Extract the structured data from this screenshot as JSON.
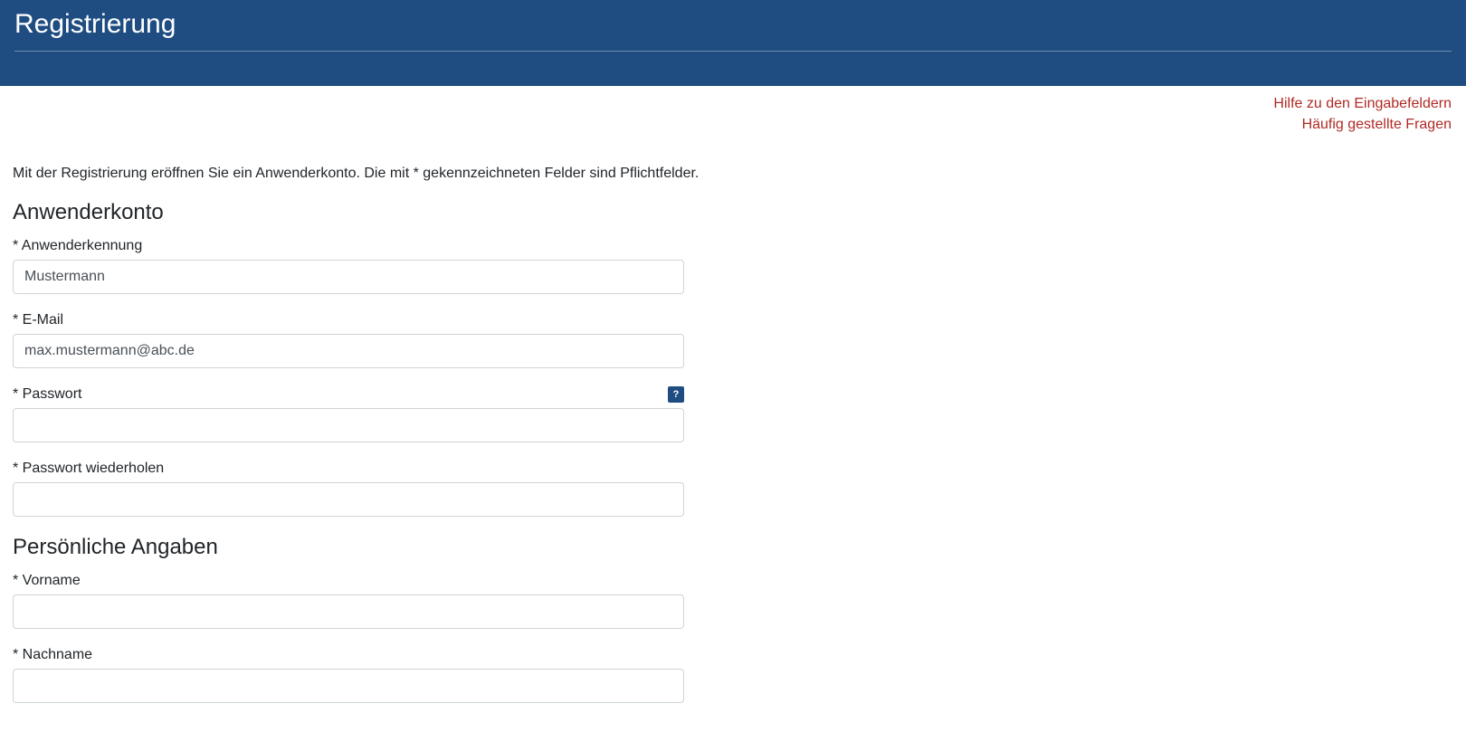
{
  "header": {
    "title": "Registrierung"
  },
  "help": {
    "link1": "Hilfe zu den Eingabefeldern",
    "link2": "Häufig gestellte Fragen"
  },
  "intro": "Mit der Registrierung eröffnen Sie ein Anwenderkonto. Die mit * gekennzeichneten Felder sind Pflichtfelder.",
  "section1": {
    "title": "Anwenderkonto",
    "username_label": "* Anwenderkennung",
    "username_value": "Mustermann",
    "email_label": "* E-Mail",
    "email_value": "max.mustermann@abc.de",
    "password_label": "* Passwort",
    "password_value": "",
    "password_help": "?",
    "password2_label": "* Passwort wiederholen",
    "password2_value": ""
  },
  "section2": {
    "title": "Persönliche Angaben",
    "firstname_label": "* Vorname",
    "firstname_value": "",
    "lastname_label": "* Nachname",
    "lastname_value": ""
  }
}
